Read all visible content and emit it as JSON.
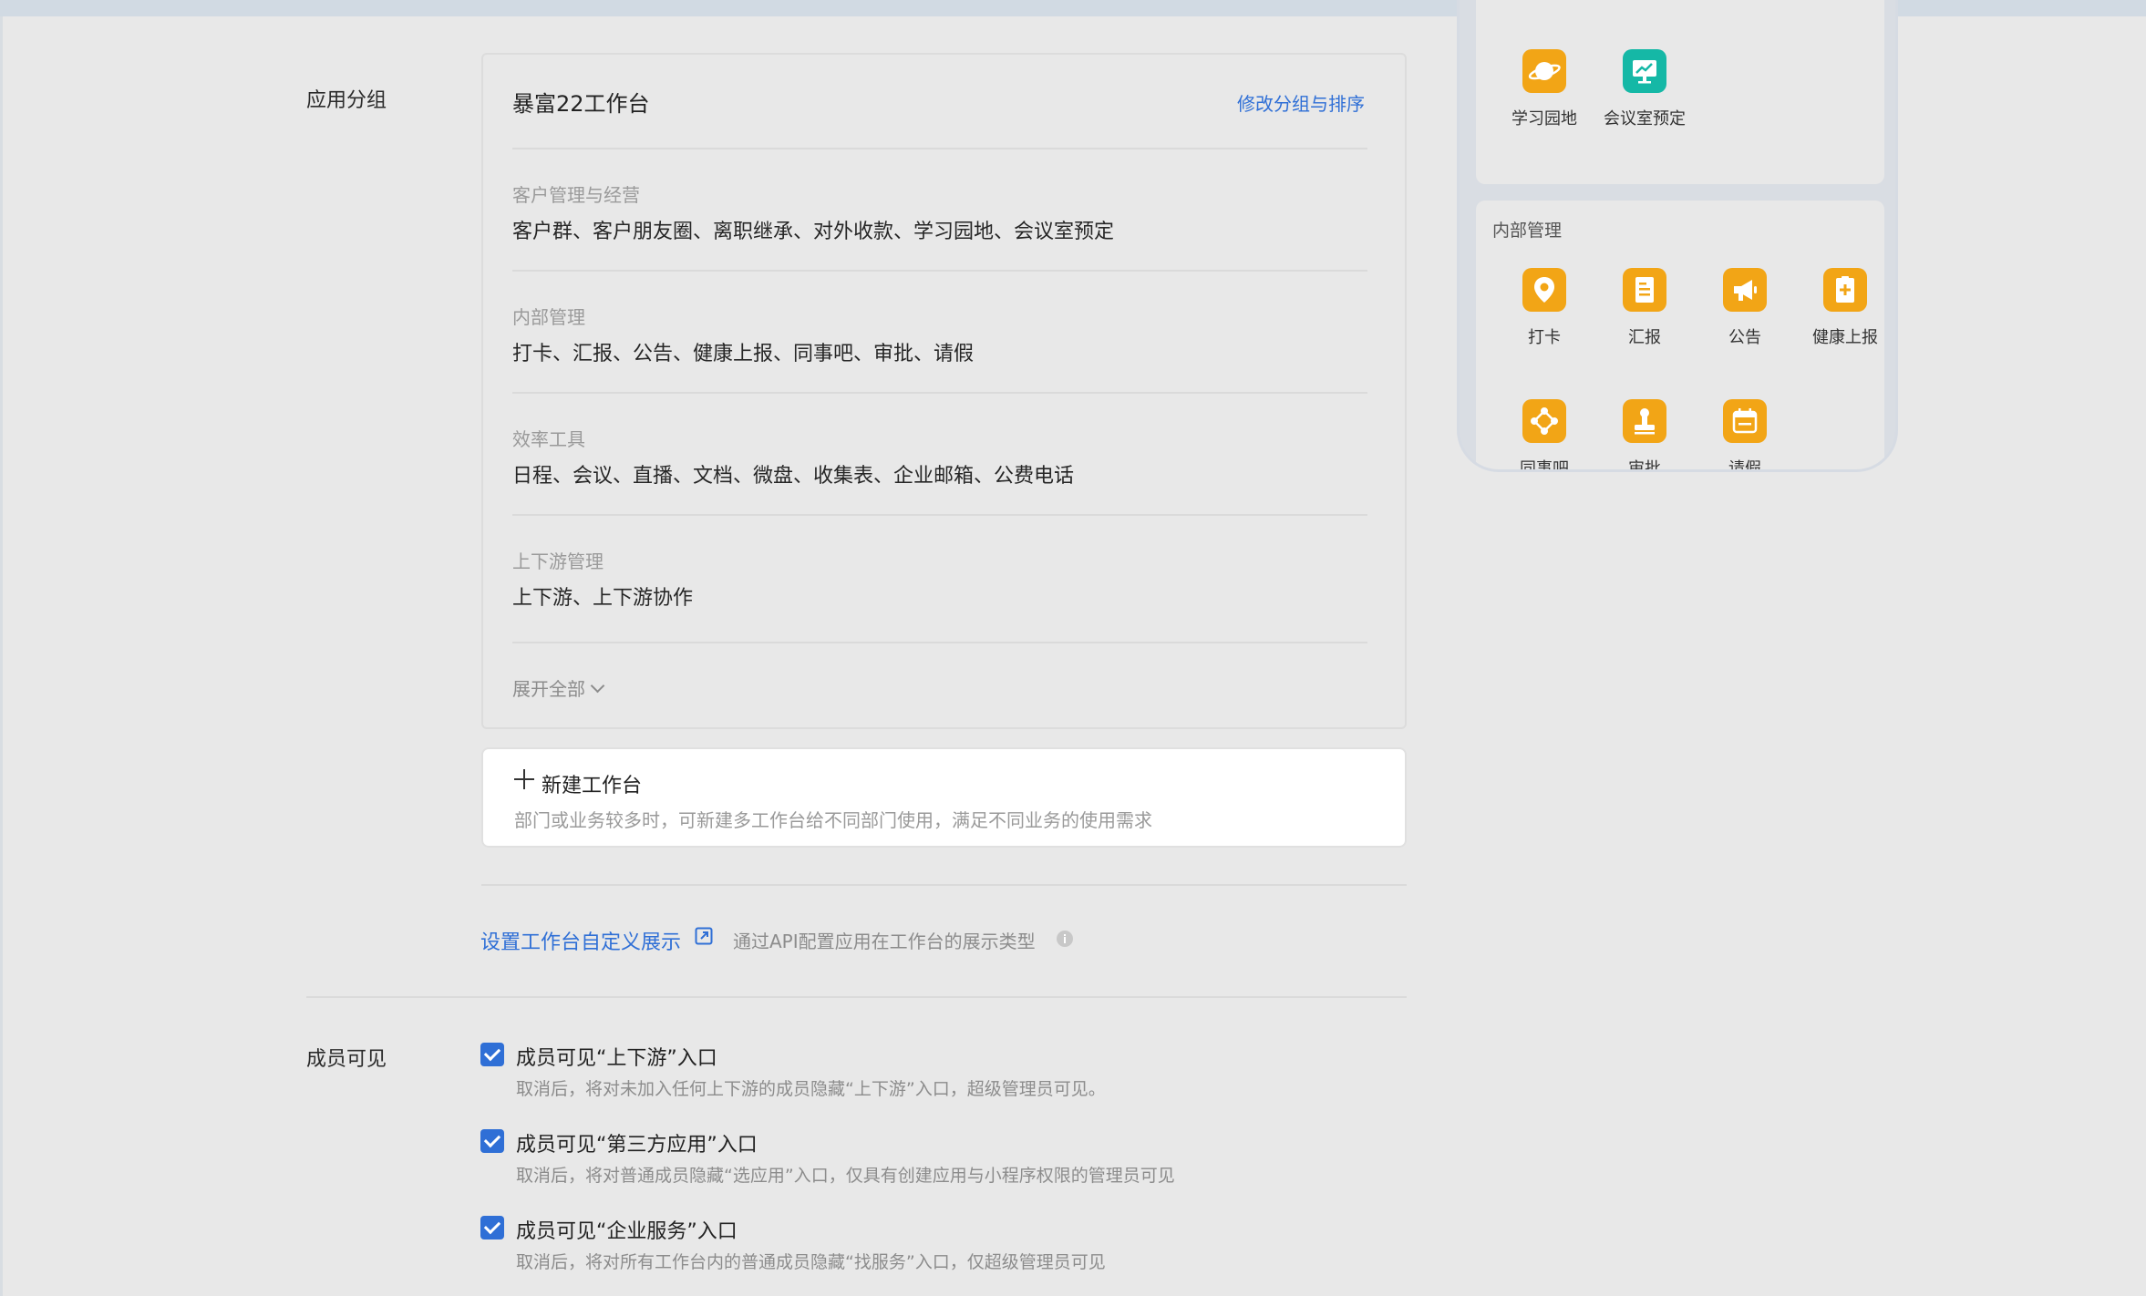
{
  "sections": {
    "app_group_label": "应用分组",
    "member_visible_label": "成员可见"
  },
  "group_card": {
    "title": "暴富22工作台",
    "edit_link": "修改分组与排序",
    "groups": [
      {
        "label": "客户管理与经营",
        "apps": "客户群、客户朋友圈、离职继承、对外收款、学习园地、会议室预定"
      },
      {
        "label": "内部管理",
        "apps": "打卡、汇报、公告、健康上报、同事吧、审批、请假"
      },
      {
        "label": "效率工具",
        "apps": "日程、会议、直播、文档、微盘、收集表、企业邮箱、公费电话"
      },
      {
        "label": "上下游管理",
        "apps": "上下游、上下游协作"
      }
    ],
    "expand_all": "展开全部"
  },
  "new_workbench": {
    "title": "新建工作台",
    "description": "部门或业务较多时，可新建多工作台给不同部门使用，满足不同业务的使用需求"
  },
  "custom_display": {
    "link": "设置工作台自定义展示",
    "description": "通过API配置应用在工作台的展示类型"
  },
  "member_options": [
    {
      "title": "成员可见“上下游”入口",
      "description": "取消后，将对未加入任何上下游的成员隐藏“上下游”入口，超级管理员可见。",
      "checked": true
    },
    {
      "title": "成员可见“第三方应用”入口",
      "description": "取消后，将对普通成员隐藏“选应用”入口，仅具有创建应用与小程序权限的管理员可见",
      "checked": true
    },
    {
      "title": "成员可见“企业服务”入口",
      "description": "取消后，将对所有工作台内的普通成员隐藏“找服务”入口，仅超级管理员可见",
      "checked": true
    }
  ],
  "preview": {
    "top_apps": [
      {
        "label": "学习园地",
        "icon": "planet-icon",
        "color": "#f2a516"
      },
      {
        "label": "会议室预定",
        "icon": "meeting-screen-icon",
        "color": "#15b8a6"
      }
    ],
    "internal_title": "内部管理",
    "internal_apps": [
      {
        "label": "打卡",
        "icon": "location-pin-icon",
        "color": "#f2a516"
      },
      {
        "label": "汇报",
        "icon": "report-document-icon",
        "color": "#f2a516"
      },
      {
        "label": "公告",
        "icon": "megaphone-icon",
        "color": "#f2a516"
      },
      {
        "label": "健康上报",
        "icon": "health-plus-icon",
        "color": "#f2a516"
      },
      {
        "label": "同事吧",
        "icon": "network-icon",
        "color": "#f2a516"
      },
      {
        "label": "审批",
        "icon": "stamp-icon",
        "color": "#f2a516"
      },
      {
        "label": "请假",
        "icon": "calendar-icon",
        "color": "#f2a516"
      }
    ]
  }
}
